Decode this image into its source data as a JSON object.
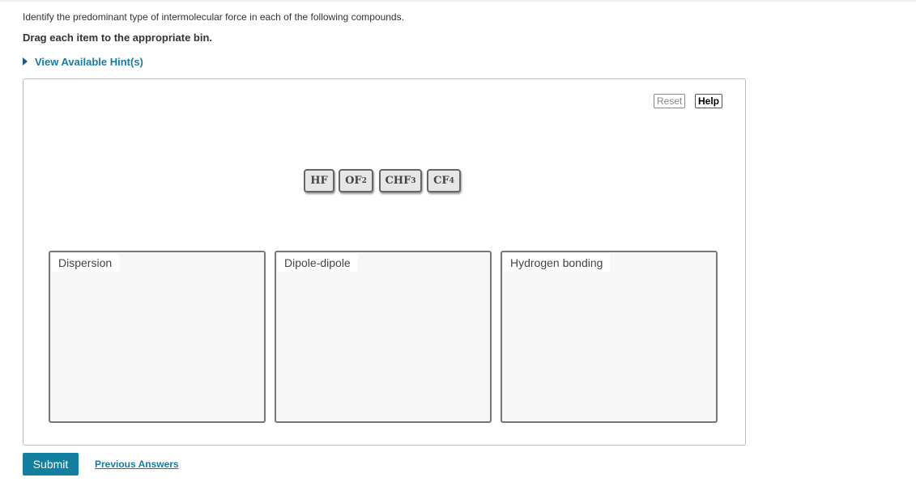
{
  "question": "Identify the predominant type of intermolecular force in each of the following compounds.",
  "instruction": "Drag each item to the appropriate bin.",
  "hint_link": "View Available Hint(s)",
  "toolbar": {
    "reset": "Reset",
    "help": "Help"
  },
  "items": [
    {
      "base": "HF",
      "sub": ""
    },
    {
      "base": "OF",
      "sub": "2"
    },
    {
      "base": "CHF",
      "sub": "3"
    },
    {
      "base": "CF",
      "sub": "4"
    }
  ],
  "bins": [
    "Dispersion",
    "Dipole-dipole",
    "Hydrogen bonding"
  ],
  "submit": "Submit",
  "previous_answers": "Previous Answers"
}
